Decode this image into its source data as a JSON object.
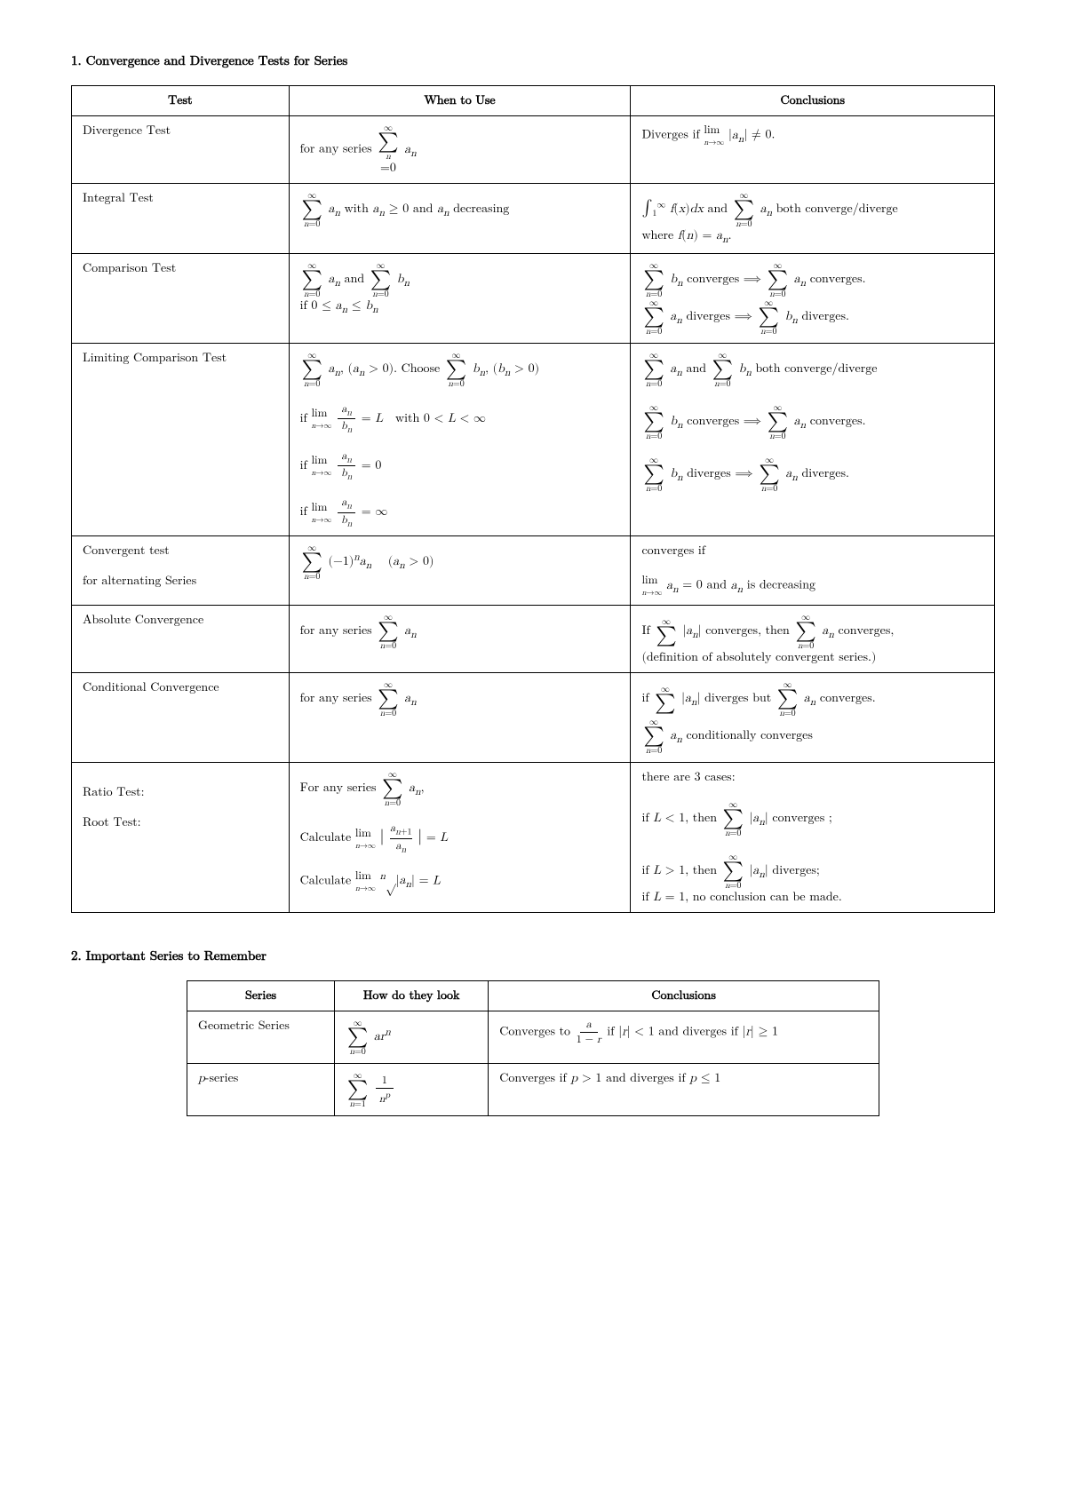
{
  "section1": {
    "title": "1.  Convergence and Divergence Tests for Series"
  },
  "section2": {
    "title": "2.  Important Series to Remember"
  },
  "table1": {
    "headers": [
      "Test",
      "When to Use",
      "Conclusions"
    ],
    "rows": [
      {
        "test": "Divergence Test",
        "when": "for any series",
        "conclusion": "diverges_if"
      }
    ]
  }
}
